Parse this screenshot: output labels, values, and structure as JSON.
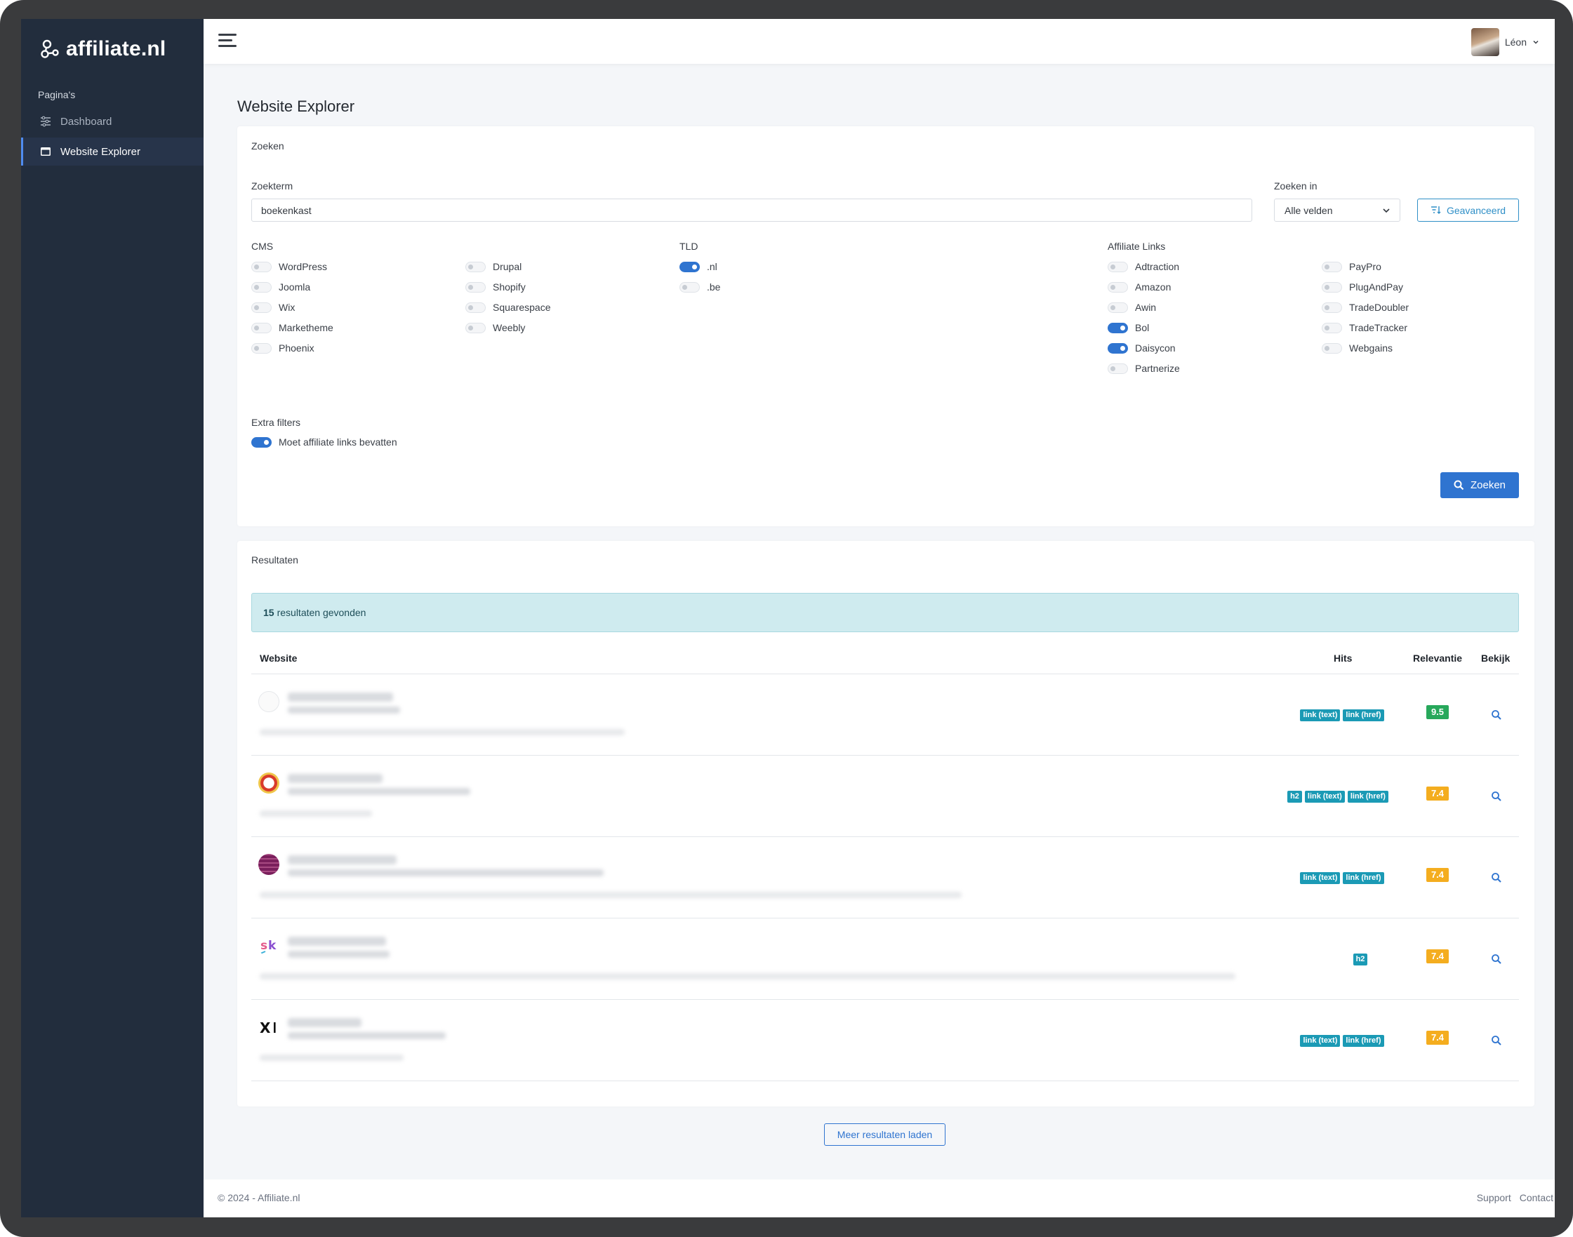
{
  "brand": {
    "name": "affiliate.nl"
  },
  "sidebar": {
    "section": "Pagina's",
    "items": [
      {
        "label": "Dashboard",
        "icon": "sliders-icon",
        "active": false
      },
      {
        "label": "Website Explorer",
        "icon": "browser-window-icon",
        "active": true
      }
    ]
  },
  "topbar": {
    "user_name": "Léon"
  },
  "page": {
    "title": "Website Explorer"
  },
  "search": {
    "card_title": "Zoeken",
    "term_label": "Zoekterm",
    "term_value": "boekenkast",
    "search_in_label": "Zoeken in",
    "search_in_value": "Alle velden",
    "advanced_label": "Geavanceerd",
    "submit_label": "Zoeken",
    "cms": {
      "label": "CMS",
      "options": [
        {
          "label": "WordPress",
          "on": false
        },
        {
          "label": "Joomla",
          "on": false
        },
        {
          "label": "Wix",
          "on": false
        },
        {
          "label": "Marketheme",
          "on": false
        },
        {
          "label": "Phoenix",
          "on": false
        },
        {
          "label": "Drupal",
          "on": false
        },
        {
          "label": "Shopify",
          "on": false
        },
        {
          "label": "Squarespace",
          "on": false
        },
        {
          "label": "Weebly",
          "on": false
        }
      ]
    },
    "tld": {
      "label": "TLD",
      "options": [
        {
          "label": ".nl",
          "on": true
        },
        {
          "label": ".be",
          "on": false
        }
      ]
    },
    "affiliate": {
      "label": "Affiliate Links",
      "options": [
        {
          "label": "Adtraction",
          "on": false
        },
        {
          "label": "Amazon",
          "on": false
        },
        {
          "label": "Awin",
          "on": false
        },
        {
          "label": "Bol",
          "on": true
        },
        {
          "label": "Daisycon",
          "on": true
        },
        {
          "label": "Partnerize",
          "on": false
        },
        {
          "label": "PayPro",
          "on": false
        },
        {
          "label": "PlugAndPay",
          "on": false
        },
        {
          "label": "TradeDoubler",
          "on": false
        },
        {
          "label": "TradeTracker",
          "on": false
        },
        {
          "label": "Webgains",
          "on": false
        }
      ]
    },
    "extra": {
      "label": "Extra filters",
      "options": [
        {
          "label": "Moet affiliate links bevatten",
          "on": true
        }
      ]
    }
  },
  "results": {
    "card_title": "Resultaten",
    "count": "15",
    "count_suffix": "resultaten gevonden",
    "columns": {
      "website": "Website",
      "hits": "Hits",
      "relevance": "Relevantie",
      "view": "Bekijk"
    },
    "rows": [
      {
        "hits": [
          "link (text)",
          "link (href)"
        ],
        "relevance": "9.5",
        "relevance_color": "#27a85b"
      },
      {
        "hits": [
          "h2",
          "link (text)",
          "link (href)"
        ],
        "relevance": "7.4",
        "relevance_color": "#f4ad1f"
      },
      {
        "hits": [
          "link (text)",
          "link (href)"
        ],
        "relevance": "7.4",
        "relevance_color": "#f4ad1f"
      },
      {
        "hits": [
          "h2"
        ],
        "relevance": "7.4",
        "relevance_color": "#f4ad1f"
      },
      {
        "hits": [
          "link (text)",
          "link (href)"
        ],
        "relevance": "7.4",
        "relevance_color": "#f4ad1f"
      }
    ],
    "load_more": "Meer resultaten laden"
  },
  "footer": {
    "copyright": "© 2024 - Affiliate.nl",
    "links": [
      "Support",
      "Contact"
    ]
  },
  "colors": {
    "sidebar": "#222d3d",
    "primary": "#2f74d0",
    "tag": "#1b9ab5",
    "alert": "#cfebef"
  }
}
